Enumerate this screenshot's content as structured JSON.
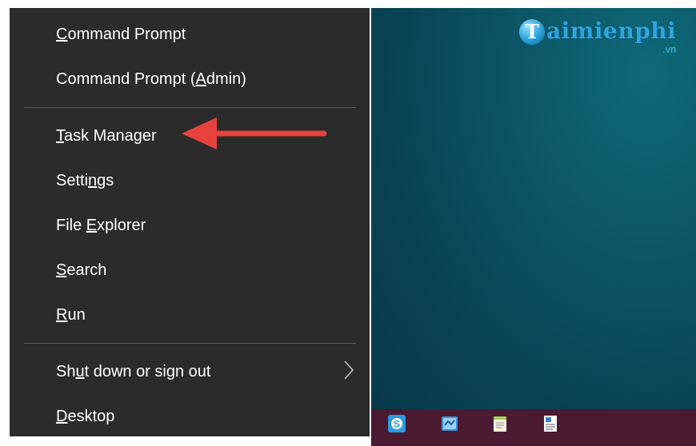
{
  "menu": {
    "items": [
      {
        "pre": "",
        "ul": "C",
        "post": "ommand Prompt"
      },
      {
        "pre": "Command Prompt (",
        "ul": "A",
        "post": "dmin)"
      },
      {
        "pre": "",
        "ul": "T",
        "post": "ask Manager"
      },
      {
        "pre": "Setti",
        "ul": "n",
        "post": "gs"
      },
      {
        "pre": "File ",
        "ul": "E",
        "post": "xplorer"
      },
      {
        "pre": "",
        "ul": "S",
        "post": "earch"
      },
      {
        "pre": "",
        "ul": "R",
        "post": "un"
      },
      {
        "pre": "Sh",
        "ul": "u",
        "post": "t down or sign out"
      },
      {
        "pre": "",
        "ul": "D",
        "post": "esktop"
      }
    ],
    "submenu_icon": "chevron-right-icon"
  },
  "annotation": {
    "icon": "red-arrow-left-icon",
    "color": "#e8423f"
  },
  "watermark": {
    "mark": "T",
    "text": "aimienphi",
    "sub": ".vn"
  },
  "taskbar": {
    "icons": [
      "skype-icon",
      "network-app-icon",
      "notepad-icon",
      "wordpad-icon"
    ]
  },
  "colors": {
    "menu_bg": "#2b2b2b",
    "menu_text": "#ffffff",
    "desktop": "#0b5565",
    "taskbar": "#4a1a30"
  }
}
